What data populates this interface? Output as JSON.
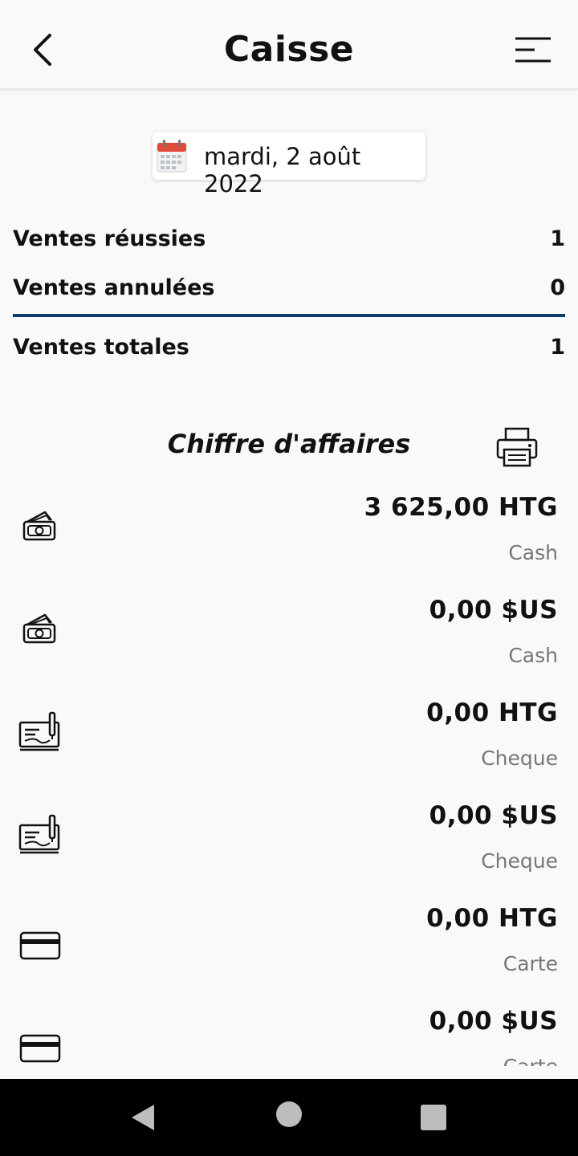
{
  "header": {
    "title": "Caisse"
  },
  "date": {
    "label": "mardi, 2 août 2022"
  },
  "stats": [
    {
      "label": "Ventes réussies",
      "value": "1"
    },
    {
      "label": "Ventes annulées",
      "value": "0"
    },
    {
      "label": "Ventes totales",
      "value": "1"
    }
  ],
  "section": {
    "title": "Chiffre d'affaires"
  },
  "payments": [
    {
      "amount": "3 625,00 HTG",
      "kind": "Cash",
      "icon": "cash-icon"
    },
    {
      "amount": "0,00 $US",
      "kind": "Cash",
      "icon": "cash-icon"
    },
    {
      "amount": "0,00 HTG",
      "kind": "Cheque",
      "icon": "cheque-icon"
    },
    {
      "amount": "0,00 $US",
      "kind": "Cheque",
      "icon": "cheque-icon"
    },
    {
      "amount": "0,00 HTG",
      "kind": "Carte",
      "icon": "card-icon"
    },
    {
      "amount": "0,00 $US",
      "kind": "Carte",
      "icon": "card-icon"
    }
  ],
  "colors": {
    "divider": "#0d3b6e",
    "background": "#f9f9f9",
    "muted_text": "#777777",
    "calendar_red": "#e04a3a"
  }
}
